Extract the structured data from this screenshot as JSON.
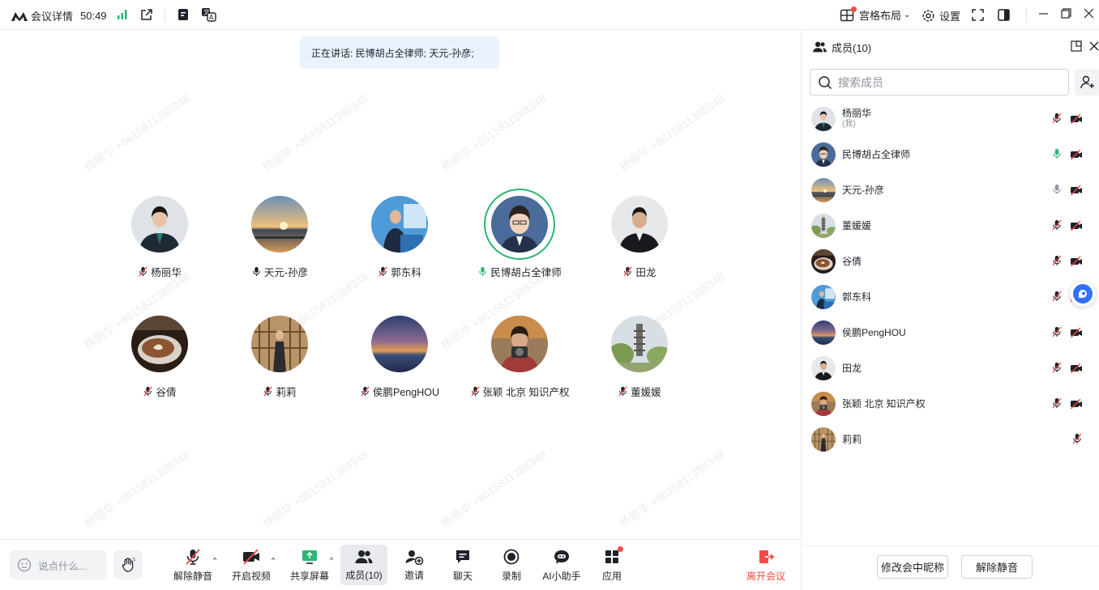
{
  "topbar": {
    "meeting_info_label": "会议详情",
    "timer": "50:49",
    "layout_label": "宫格布局",
    "settings_label": "设置"
  },
  "stage": {
    "speaking_text": "正在讲话: 民博胡占全律师; 天元-孙彦;",
    "watermark": "杨丽华 +8615811388348",
    "tiles": [
      {
        "name": "杨丽华",
        "mic": "muted",
        "avatar": "woman-dark-suit"
      },
      {
        "name": "天元-孙彦",
        "mic": "on",
        "avatar": "sunset-lake"
      },
      {
        "name": "郭东科",
        "mic": "muted",
        "avatar": "man-podium-blue"
      },
      {
        "name": "民博胡占全律师",
        "mic": "speaking",
        "avatar": "cartoon-man"
      },
      {
        "name": "田龙",
        "mic": "muted",
        "avatar": "man-black-suit"
      },
      {
        "name": "谷倩",
        "mic": "muted",
        "avatar": "coffee-cup"
      },
      {
        "name": "莉莉",
        "mic": "muted",
        "avatar": "woman-window"
      },
      {
        "name": "侯鹏PengHOU",
        "mic": "muted",
        "avatar": "dusk-sky"
      },
      {
        "name": "张颖 北京 知识产权",
        "mic": "muted",
        "avatar": "woman-camera"
      },
      {
        "name": "董媛媛",
        "mic": "muted",
        "avatar": "pagoda-tree"
      }
    ]
  },
  "toolbar": {
    "chat_placeholder": "说点什么...",
    "unmute_label": "解除静音",
    "video_label": "开启视频",
    "share_label": "共享屏幕",
    "members_label": "成员(10)",
    "invite_label": "邀请",
    "chat_label": "聊天",
    "record_label": "录制",
    "ai_label": "AI小助手",
    "apps_label": "应用",
    "leave_label": "离开会议"
  },
  "sidebar": {
    "title": "成员(10)",
    "search_placeholder": "搜索成员",
    "members": [
      {
        "name": "杨丽华",
        "sub": "(我)",
        "mic": "muted",
        "cam": "off",
        "avatar": "woman-dark-suit"
      },
      {
        "name": "民博胡占全律师",
        "sub": "",
        "mic": "speaking",
        "cam": "off",
        "avatar": "cartoon-man"
      },
      {
        "name": "天元-孙彦",
        "sub": "",
        "mic": "on",
        "cam": "off",
        "avatar": "sunset-lake"
      },
      {
        "name": "董媛媛",
        "sub": "",
        "mic": "muted",
        "cam": "off",
        "avatar": "pagoda-tree"
      },
      {
        "name": "谷倩",
        "sub": "",
        "mic": "muted",
        "cam": "off",
        "avatar": "coffee-cup"
      },
      {
        "name": "郭东科",
        "sub": "",
        "mic": "muted",
        "cam": "off",
        "avatar": "man-podium-blue"
      },
      {
        "name": "侯鹏PengHOU",
        "sub": "",
        "mic": "muted",
        "cam": "off",
        "avatar": "dusk-sky"
      },
      {
        "name": "田龙",
        "sub": "",
        "mic": "muted",
        "cam": "off",
        "avatar": "man-black-suit"
      },
      {
        "name": "张颖 北京 知识产权",
        "sub": "",
        "mic": "muted",
        "cam": "off",
        "avatar": "woman-camera"
      },
      {
        "name": "莉莉",
        "sub": "",
        "mic": "muted",
        "cam": "none",
        "avatar": "woman-window"
      }
    ],
    "rename_button": "修改会中昵称",
    "unmute_button": "解除静音"
  },
  "colors": {
    "accent_green": "#2bb673",
    "leave_red": "#f54a45",
    "brand_blue": "#3370ff"
  }
}
